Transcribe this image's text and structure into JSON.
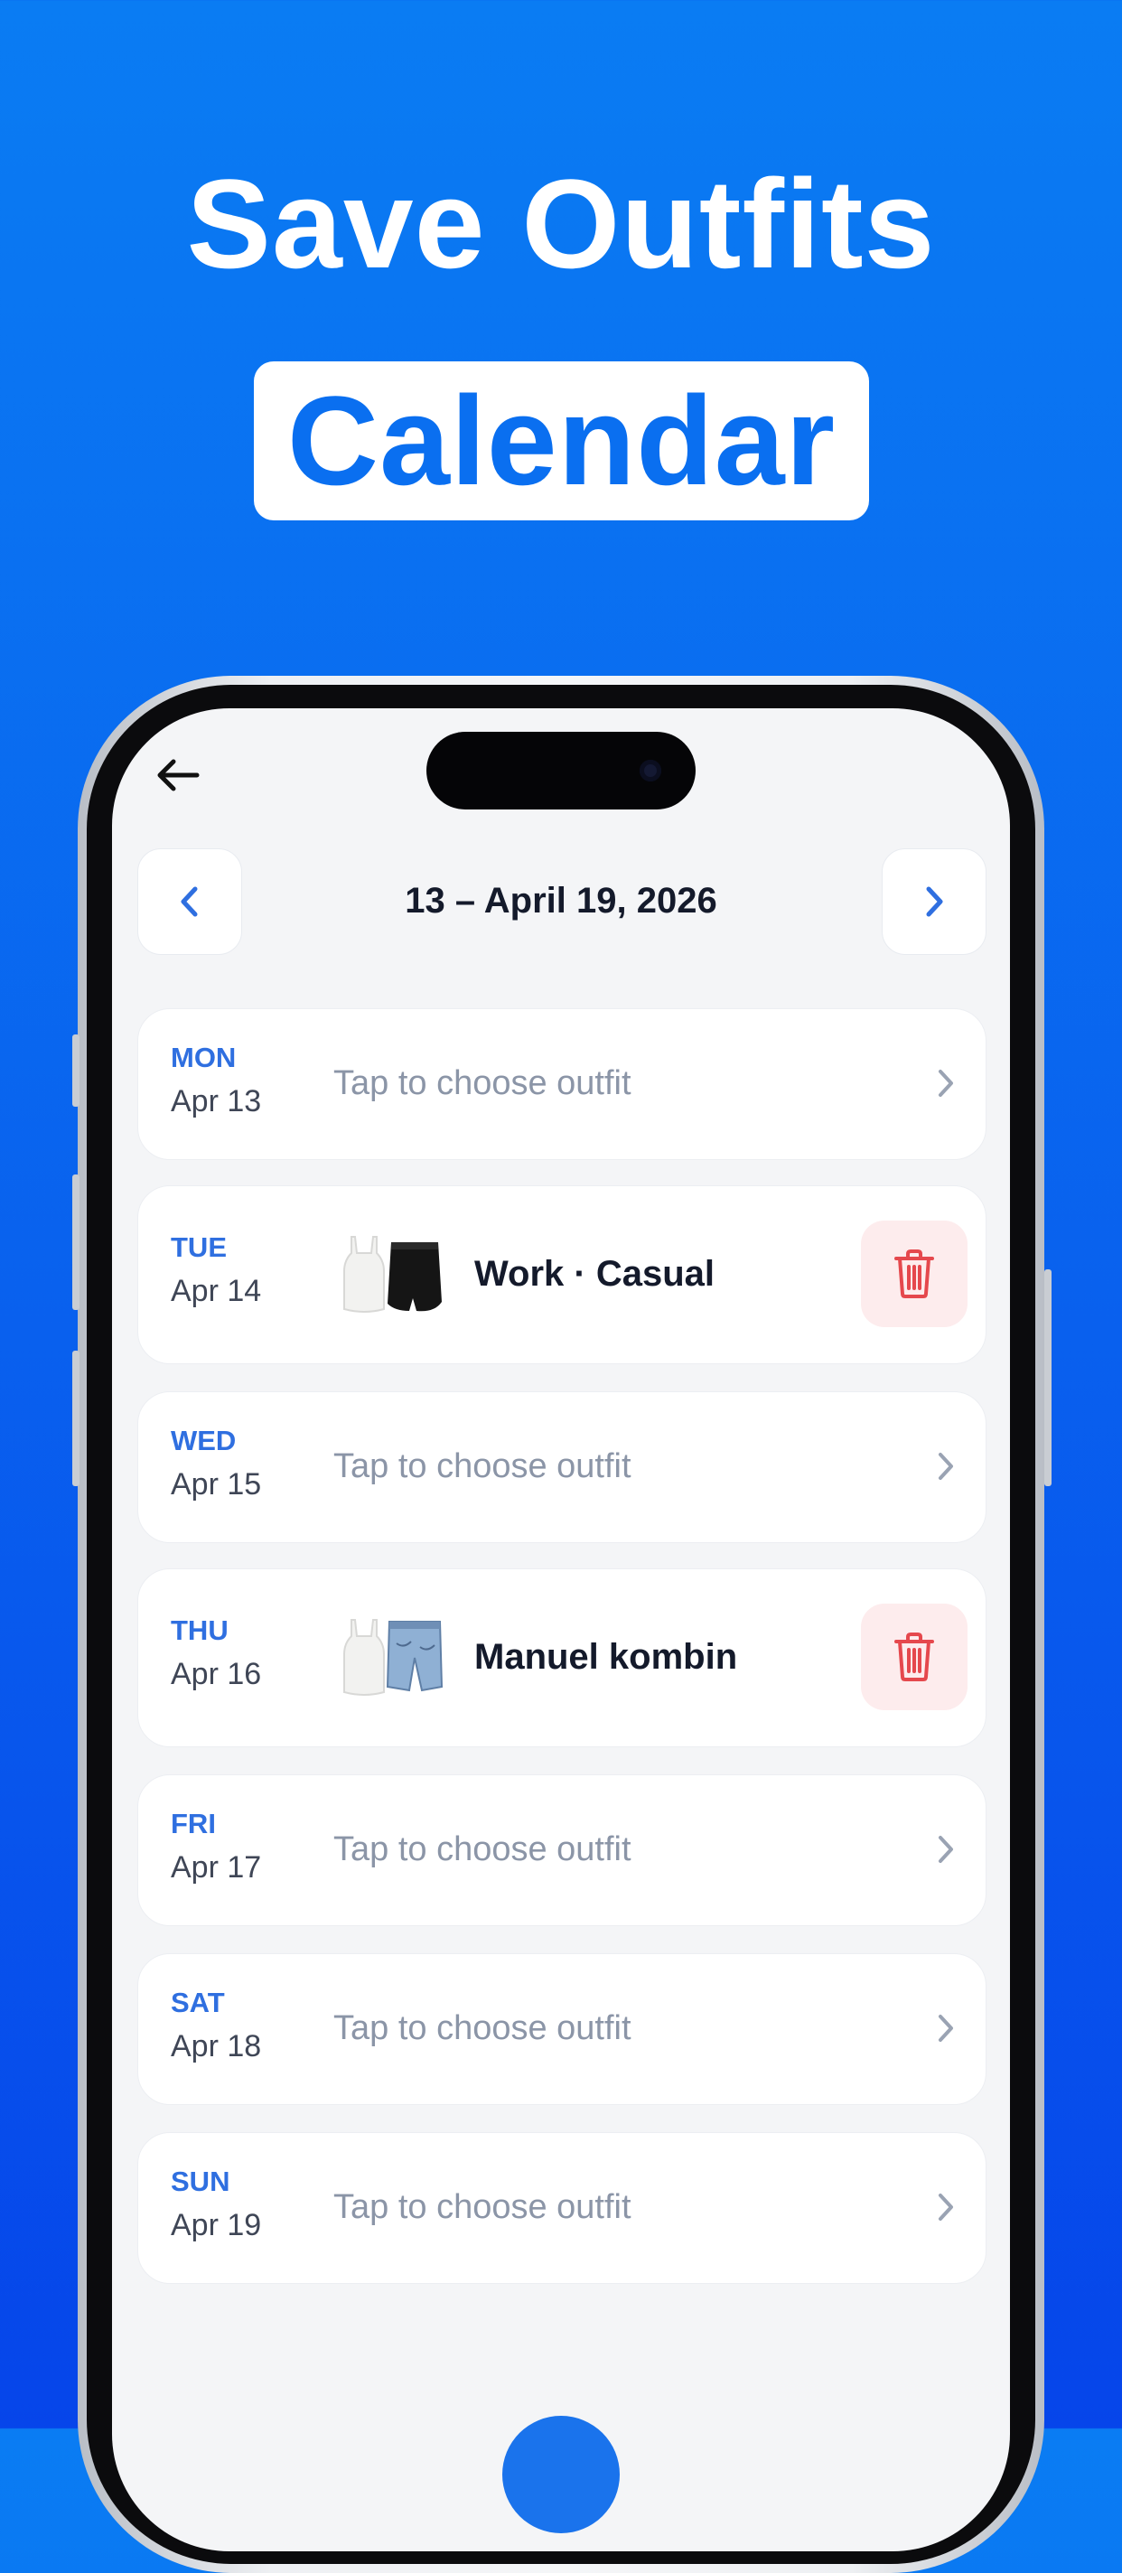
{
  "promo": {
    "headline": "Save Outfits",
    "highlight": "Calendar"
  },
  "calendar": {
    "week_label": "13 – April 19, 2026",
    "hint_text": "Tap to choose outfit",
    "days": [
      {
        "dow": "MON",
        "date": "Apr 13",
        "hint": "Tap to choose outfit"
      },
      {
        "dow": "TUE",
        "date": "Apr 14",
        "outfit": "Work · Casual"
      },
      {
        "dow": "WED",
        "date": "Apr 15",
        "hint": "Tap to choose outfit"
      },
      {
        "dow": "THU",
        "date": "Apr 16",
        "outfit": "Manuel kombin"
      },
      {
        "dow": "FRI",
        "date": "Apr 17",
        "hint": "Tap to choose outfit"
      },
      {
        "dow": "SAT",
        "date": "Apr 18",
        "hint": "Tap to choose outfit"
      },
      {
        "dow": "SUN",
        "date": "Apr 19",
        "hint": "Tap to choose outfit"
      }
    ]
  },
  "colors": {
    "background": "#0a6ff0",
    "accent": "#2f6fe0",
    "delete": "#e5484d",
    "delete_bg": "#fdeced"
  },
  "icons": {
    "back": "arrow-left-icon",
    "prev": "chevron-left-icon",
    "next": "chevron-right-icon",
    "row": "chevron-right-icon",
    "delete": "trash-icon"
  }
}
